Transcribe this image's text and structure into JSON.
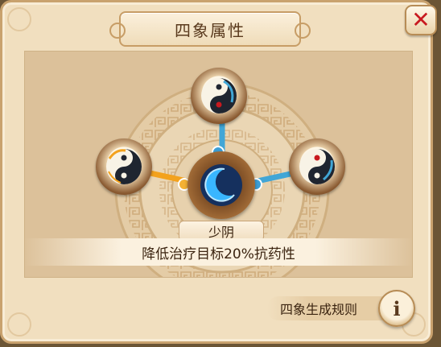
{
  "dialog": {
    "title": "四象属性",
    "close_symbol": "✕"
  },
  "element": {
    "name": "少阴",
    "description": "降低治疗目标20%抗药性"
  },
  "footer": {
    "rules_label": "四象生成规则",
    "info_symbol": "i"
  },
  "icons": {
    "close": "close-icon",
    "info": "info-icon",
    "symbols": [
      "yin-yang-icon-left",
      "yin-yang-icon-top",
      "yin-yang-icon-right",
      "crescent-moon-icon"
    ]
  },
  "colors": {
    "frame": "#f1dfbf",
    "panel": "#dcc19a",
    "close_x": "#c8191f",
    "connector_active": "#f3a21d",
    "connector_blue": "#41a6d6",
    "text": "#3b2410"
  }
}
